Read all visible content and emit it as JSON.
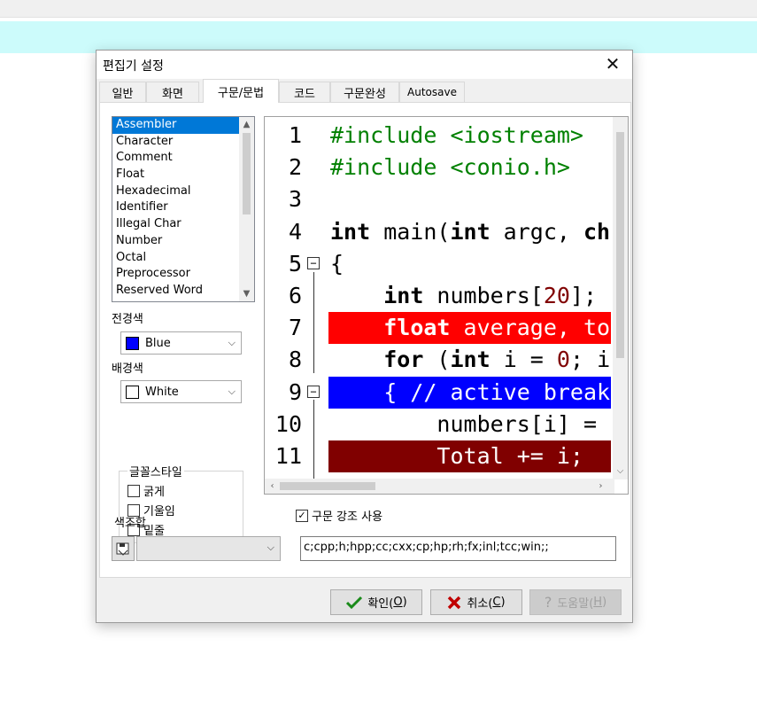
{
  "dialog": {
    "title": "편집기 설정",
    "close_glyph": "✕",
    "tabs": [
      {
        "label": "일반"
      },
      {
        "label": "화면"
      },
      {
        "label": "구문/문법"
      },
      {
        "label": "코드"
      },
      {
        "label": "구문완성"
      },
      {
        "label": "Autosave"
      }
    ],
    "active_tab": "구문/문법"
  },
  "syntax": {
    "elements": [
      "Assembler",
      "Character",
      "Comment",
      "Float",
      "Hexadecimal",
      "Identifier",
      "Illegal Char",
      "Number",
      "Octal",
      "Preprocessor",
      "Reserved Word"
    ],
    "selected_element": "Assembler",
    "foreground_label": "전경색",
    "foreground_value": "Blue",
    "foreground_color": "#0000ff",
    "background_label": "배경색",
    "background_value": "White",
    "background_color": "#ffffff",
    "font_style_label": "글꼴스타일",
    "styles": [
      "굵게",
      "기울임",
      "밑줄"
    ],
    "color_scheme_label": "색조합",
    "color_scheme_value": "",
    "enable_label": "구문 강조 사용",
    "enable_checked": true,
    "extensions": "c;cpp;h;hpp;cc;cxx;cp;hp;rh;fx;inl;tcc;win;;"
  },
  "preview": {
    "lines": [
      {
        "n": "1",
        "code": "#include <iostream>",
        "fold": false,
        "bg": "",
        "fg": ""
      },
      {
        "n": "2",
        "code": "#include <conio.h>",
        "fold": false,
        "bg": "",
        "fg": ""
      },
      {
        "n": "3",
        "code": "",
        "fold": false,
        "bg": "",
        "fg": ""
      },
      {
        "n": "4",
        "code": "int main(int argc, char",
        "fold": false,
        "bg": "",
        "fg": ""
      },
      {
        "n": "5",
        "code": "{",
        "fold": true,
        "bg": "",
        "fg": ""
      },
      {
        "n": "6",
        "code": "    int numbers[20];",
        "fold": false,
        "bg": "",
        "fg": ""
      },
      {
        "n": "7",
        "code": "    float average, total",
        "fold": false,
        "bg": "#ff0000",
        "fg": "#ffffff"
      },
      {
        "n": "8",
        "code": "    for (int i = 0; i",
        "fold": false,
        "bg": "",
        "fg": ""
      },
      {
        "n": "9",
        "code": "    { // active break",
        "fold": true,
        "bg": "#0000ff",
        "fg": "#ffffff"
      },
      {
        "n": "10",
        "code": "        numbers[i] = i",
        "fold": false,
        "bg": "",
        "fg": ""
      },
      {
        "n": "11",
        "code": "        Total += i;",
        "fold": false,
        "bg": "#800000",
        "fg": "#ffffff"
      }
    ]
  },
  "buttons": {
    "ok": "확인(",
    "ok_key": "O",
    "cancel": "취소(",
    "cancel_key": "C",
    "help": "도움말(",
    "help_key": "H",
    "close_paren": ")"
  }
}
